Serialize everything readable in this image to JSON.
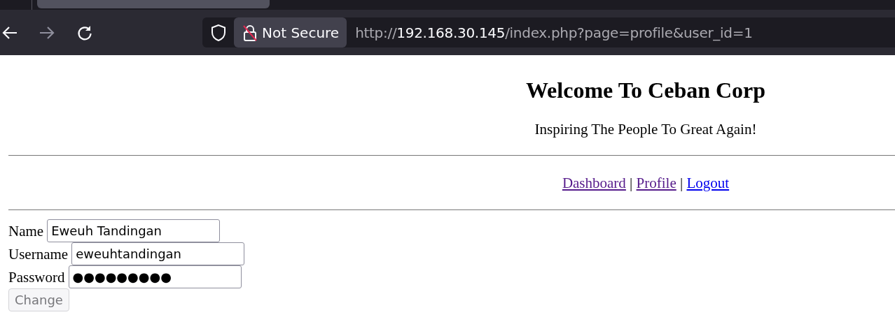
{
  "browser": {
    "security_label": "Not Secure",
    "url": {
      "scheme": "http://",
      "host": "192.168.30.145",
      "path": "/index.php?page=profile&user_id=1"
    }
  },
  "page": {
    "heading": "Welcome To Ceban Corp",
    "tagline": "Inspiring The People To Great Again!",
    "nav": [
      {
        "label": "Dashboard",
        "visited": true
      },
      {
        "label": "Profile",
        "visited": true
      },
      {
        "label": "Logout",
        "visited": false
      }
    ],
    "separator": "|",
    "form": {
      "fields": [
        {
          "label": "Name",
          "value": "Eweuh Tandingan"
        },
        {
          "label": "Username",
          "value": "eweuhtandingan"
        },
        {
          "label": "Password",
          "value": "●●●●●●●●●"
        }
      ],
      "submit": {
        "label": "Change",
        "disabled": true
      }
    }
  }
}
